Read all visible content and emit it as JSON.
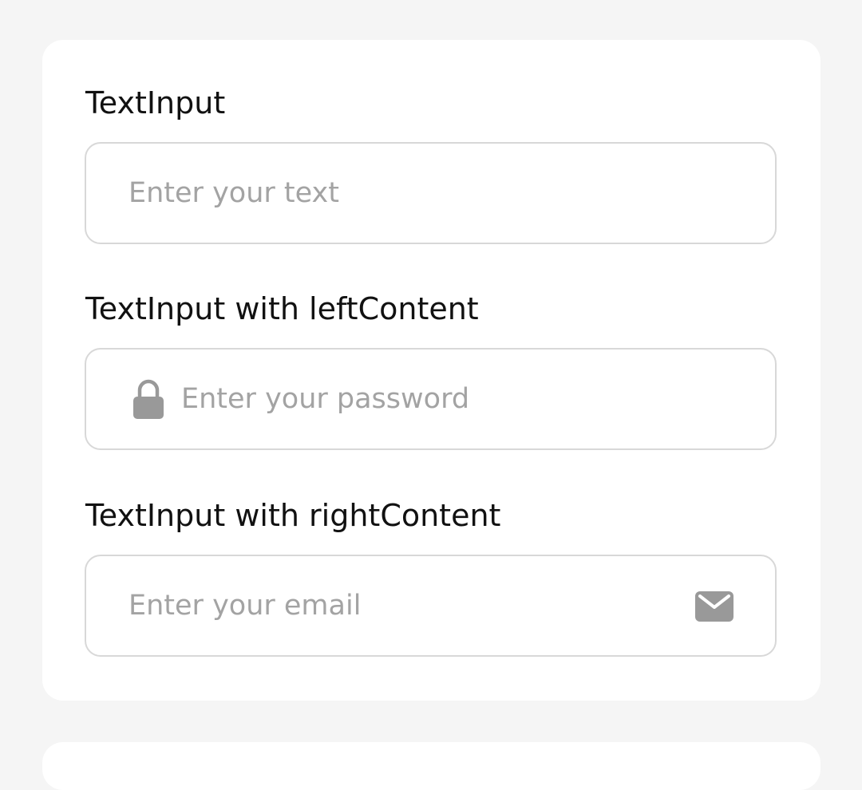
{
  "sections": [
    {
      "label": "TextInput",
      "input": {
        "placeholder": "Enter your text",
        "value": ""
      }
    },
    {
      "label": "TextInput with leftContent",
      "input": {
        "placeholder": "Enter your password",
        "value": ""
      },
      "left_icon": "lock-icon"
    },
    {
      "label": "TextInput with rightContent",
      "input": {
        "placeholder": "Enter your email",
        "value": ""
      },
      "right_icon": "mail-icon"
    }
  ],
  "colors": {
    "page_background": "#f5f5f5",
    "card_background": "#ffffff",
    "field_border": "#d8d8d8",
    "placeholder": "#a3a3a3",
    "icon": "#999999",
    "label_text": "#111111"
  }
}
